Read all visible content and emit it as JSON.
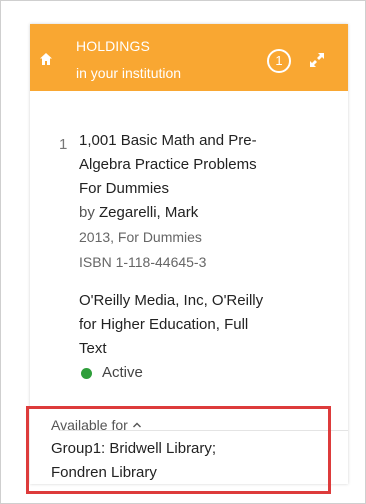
{
  "header": {
    "title": "HOLDINGS",
    "subtitle": "in your institution",
    "count": "1",
    "color": "#f9a732"
  },
  "item": {
    "number": "1",
    "title_lines": [
      "1,001 Basic Math and Pre-",
      "Algebra Practice Problems",
      "For Dummies"
    ],
    "by_label": "by",
    "author": "Zegarelli, Mark",
    "year_publisher": "2013, For Dummies",
    "isbn": "ISBN 1-118-44645-3",
    "provider_lines": [
      "O'Reilly Media, Inc, O'Reilly",
      "for Higher Education, Full",
      "Text"
    ],
    "status": "Active",
    "status_color": "#2e9e3a"
  },
  "availability": {
    "toggle_label": "Available for",
    "lines": [
      "Group1: Bridwell Library;",
      "Fondren Library"
    ],
    "highlight_color": "#dd3b3b"
  },
  "icons": {
    "home": "home-icon",
    "expand": "expand-icon",
    "caret": "chevron-up-icon"
  }
}
